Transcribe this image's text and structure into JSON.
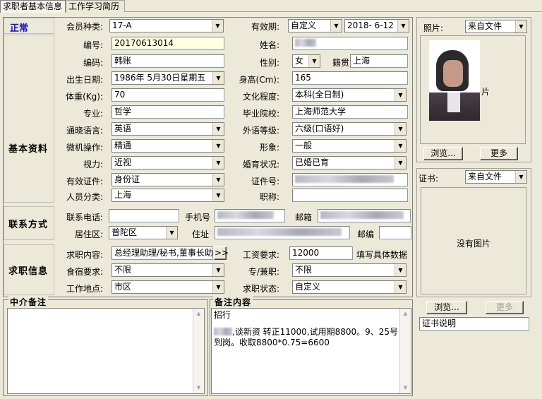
{
  "tabs": [
    "求职者基本信息",
    "工作学习简历"
  ],
  "status": "正常",
  "member_type": {
    "label": "会员种类:",
    "value": "17-A"
  },
  "validity": {
    "label": "有效期:",
    "mode": "自定义",
    "date": "2018- 6-12"
  },
  "photo": {
    "label": "照片:",
    "source": "来自文件",
    "caption": "片",
    "browse": "浏览...",
    "more": "更多"
  },
  "cert": {
    "label": "证书:",
    "source": "来自文件",
    "empty": "没有图片",
    "browse": "浏览...",
    "more": "更多",
    "note": "证书说明"
  },
  "basic": {
    "section": "基本资料",
    "number_label": "编号:",
    "number": "20170613014",
    "name_label": "姓名:",
    "code_label": "编码:",
    "code": "韩账",
    "gender_label": "性别:",
    "gender": "女",
    "origin_label": "籍贯",
    "origin": "上海",
    "birth_label": "出生日期:",
    "birth": "1986年 5月30日星期五",
    "height_label": "身高(Cm):",
    "height": "165",
    "weight_label": "体重(Kg):",
    "weight": "70",
    "edu_label": "文化程度:",
    "edu": "本科(全日制)",
    "major_label": "专业:",
    "major": "哲学",
    "school_label": "毕业院校:",
    "school": "上海师范大学",
    "lang_label": "通晓语言:",
    "lang": "英语",
    "lang_level_label": "外语等级:",
    "lang_level": "六级(口语好)",
    "computer_label": "微机操作:",
    "computer": "精通",
    "image_label": "形象:",
    "image": "一般",
    "vision_label": "视力:",
    "vision": "近视",
    "marital_label": "婚育状况:",
    "marital": "已婚已育",
    "id_type_label": "有效证件:",
    "id_type": "身份证",
    "id_no_label": "证件号:",
    "category_label": "人员分类:",
    "category": "上海",
    "title_label": "职称:",
    "title": ""
  },
  "contact": {
    "section": "联系方式",
    "phone_label": "联系电话:",
    "phone": "",
    "mobile_label": "手机号",
    "email_label": "邮箱",
    "district_label": "居住区:",
    "district": "普陀区",
    "address_label": "住址",
    "zip_label": "邮编",
    "zip": ""
  },
  "job": {
    "section": "求职信息",
    "content_label": "求职内容:",
    "content": "总经理助理/秘书,董事长助",
    "more_btn": ">>",
    "salary_label": "工资要求:",
    "salary": "12000",
    "salary_hint": "填写具体数据",
    "board_label": "食宿要求:",
    "board": "不限",
    "type_label": "专/兼职:",
    "type": "不限",
    "location_label": "工作地点:",
    "location": "市区",
    "state_label": "求职状态:",
    "state": "自定义"
  },
  "agency_note": {
    "title": "中介备注",
    "text": ""
  },
  "remark": {
    "title": "备注内容",
    "line1": "招行",
    "line2": ",谈新资 转正11000,试用期8800。9、25号",
    "line3": "到岗。收取8800*0.75=6600"
  }
}
